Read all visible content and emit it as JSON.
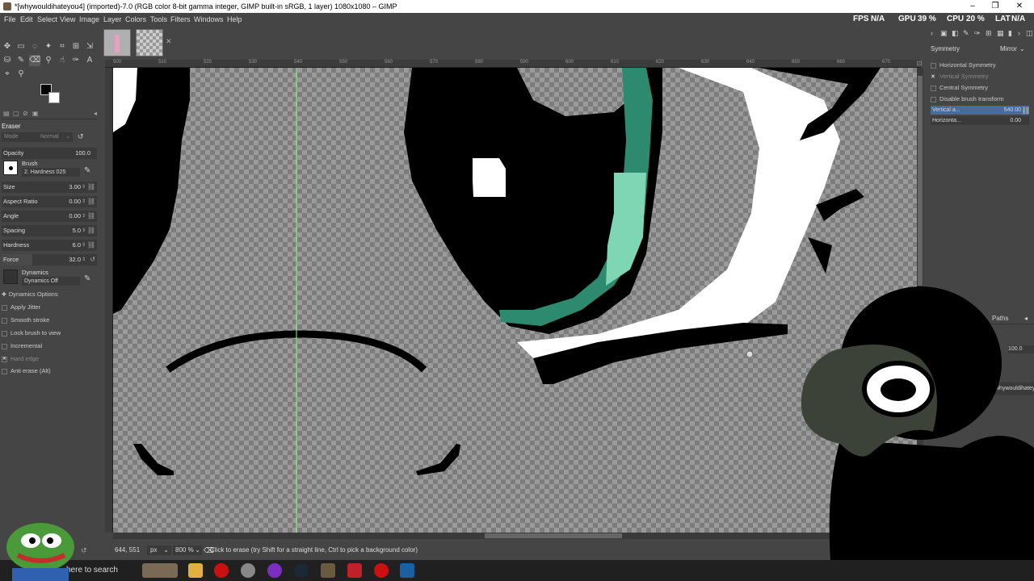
{
  "window": {
    "title": "*[whywouldihateyou4] (imported)-7.0 (RGB color 8-bit gamma integer, GIMP built-in sRGB, 1 layer) 1080x1080 – GIMP",
    "minimize": "–",
    "maximize": "❐",
    "close": "✕"
  },
  "menu": [
    "File",
    "Edit",
    "Select",
    "View",
    "Image",
    "Layer",
    "Colors",
    "Tools",
    "Filters",
    "Windows",
    "Help"
  ],
  "overlay_stats": {
    "fps_label": "FPS",
    "fps_value": "N/A",
    "gpu_label": "GPU",
    "gpu_value": "39 %",
    "cpu_label": "CPU",
    "cpu_value": "20 %",
    "lat_label": "LAT",
    "lat_value": "N/A"
  },
  "tool_options": {
    "tool_name": "Eraser",
    "mode_label": "Mode",
    "mode_value": "Normal",
    "opacity_label": "Opacity",
    "opacity_value": "100.0",
    "brush_label": "Brush",
    "brush_value": "2. Hardness 025",
    "size_label": "Size",
    "size_value": "3.00",
    "aspect_label": "Aspect Ratio",
    "aspect_value": "0.00",
    "angle_label": "Angle",
    "angle_value": "0.00",
    "spacing_label": "Spacing",
    "spacing_value": "5.0",
    "hardness_label": "Hardness",
    "hardness_value": "6.0",
    "force_label": "Force",
    "force_value": "32.0",
    "dynamics_label": "Dynamics",
    "dynamics_value": "Dynamics Off",
    "options": [
      "Dynamics Options",
      "Apply Jitter",
      "Smooth stroke",
      "Lock brush to view",
      "Incremental",
      "Hard edge",
      "Anti erase  (Alt)"
    ]
  },
  "ruler_ticks": [
    "500",
    "510",
    "520",
    "530",
    "540",
    "550",
    "560",
    "570",
    "580",
    "590",
    "600",
    "610",
    "620",
    "630",
    "640",
    "650",
    "660",
    "670"
  ],
  "status": {
    "coords": "644, 551",
    "unit": "px",
    "zoom": "800 %",
    "message": "Click to erase (try Shift for a straight line, Ctrl to pick a background color)"
  },
  "symmetry": {
    "title": "Symmetry",
    "mode": "Mirror",
    "horizontal": "Horizontal Symmetry",
    "vertical": "Vertical Symmetry",
    "central": "Central Symmetry",
    "disable": "Disable brush transform",
    "vertical_axis_label": "Vertical a...",
    "vertical_axis_value": "540.00",
    "horizontal_axis_label": "Horizonta...",
    "horizontal_axis_value": "0.00"
  },
  "layers": {
    "paths_tab": "Paths",
    "opacity_value": "100.0",
    "layer_name": "whywouldihatey"
  },
  "taskbar": {
    "search_text": "here to search"
  },
  "colors": {
    "teal_dark": "#2e8a6e",
    "teal_light": "#7ed6b4",
    "checker_light": "#9a9a9a",
    "checker_dark": "#7c7c7c"
  }
}
